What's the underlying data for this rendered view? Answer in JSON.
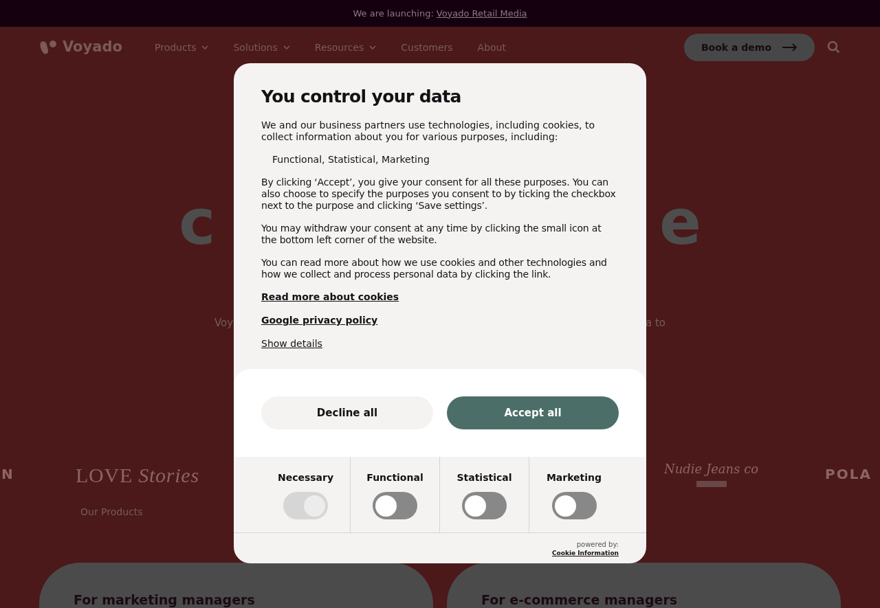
{
  "announcement": {
    "text": "We are launching:",
    "link": "Voyado Retail Media"
  },
  "nav": {
    "logo": "Voyado",
    "items": [
      {
        "label": "Products",
        "dropdown": true
      },
      {
        "label": "Solutions",
        "dropdown": true
      },
      {
        "label": "Resources",
        "dropdown": true
      },
      {
        "label": "Customers",
        "dropdown": false
      },
      {
        "label": "About",
        "dropdown": false
      }
    ],
    "cta": "Book a demo"
  },
  "hero": {
    "headline_left": "c",
    "headline_right": "e",
    "subtitle_left": "Voy",
    "subtitle_right": "a to"
  },
  "logos": [
    {
      "kind": "plain",
      "text": "N"
    },
    {
      "kind": "serif",
      "text": "LOVE *Stories*"
    },
    {
      "kind": "script",
      "text": "Nudie Jeans co"
    },
    {
      "kind": "plain",
      "text": "POLA"
    }
  ],
  "section_label": "Our Products",
  "cards": [
    "For marketing managers",
    "For e-commerce managers"
  ],
  "consent": {
    "title": "You control your data",
    "intro": "We and our business partners use technologies, including cookies, to collect information about you for various purposes, including:",
    "purposes": "Functional, Statistical, Marketing",
    "paragraphs": [
      "By clicking ‘Accept’, you give your consent for all these purposes. You can also choose to specify the purposes you consent to by ticking the checkbox next to the purpose and clicking ‘Save settings’.",
      "You may withdraw your consent at any time by clicking the small icon at the bottom left corner of the website.",
      "You can read more about how we use cookies and other technologies and how we collect and process personal data by clicking the link."
    ],
    "links": [
      "Read more about cookies",
      "Google privacy policy"
    ],
    "show_details": "Show details",
    "decline": "Decline all",
    "accept": "Accept all",
    "toggles": [
      {
        "label": "Necessary",
        "on": true,
        "disabled": true
      },
      {
        "label": "Functional",
        "on": false,
        "disabled": false
      },
      {
        "label": "Statistical",
        "on": false,
        "disabled": false
      },
      {
        "label": "Marketing",
        "on": false,
        "disabled": false
      }
    ],
    "powered_by": "powered by:",
    "provider": "Cookie Information"
  }
}
